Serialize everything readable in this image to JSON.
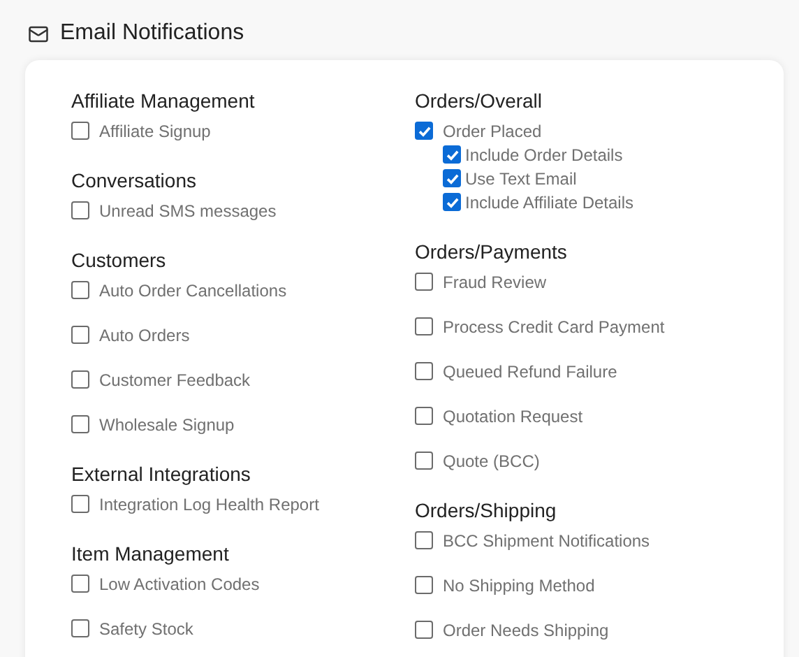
{
  "header": {
    "title": "Email Notifications"
  },
  "columns": [
    {
      "groups": [
        {
          "title": "Affiliate Management",
          "items": [
            {
              "label": "Affiliate Signup",
              "checked": false
            }
          ]
        },
        {
          "title": "Conversations",
          "items": [
            {
              "label": "Unread SMS messages",
              "checked": false
            }
          ]
        },
        {
          "title": "Customers",
          "items": [
            {
              "label": "Auto Order Cancellations",
              "checked": false
            },
            {
              "label": "Auto Orders",
              "checked": false
            },
            {
              "label": "Customer Feedback",
              "checked": false
            },
            {
              "label": "Wholesale Signup",
              "checked": false
            }
          ]
        },
        {
          "title": "External Integrations",
          "items": [
            {
              "label": "Integration Log Health Report",
              "checked": false
            }
          ]
        },
        {
          "title": "Item Management",
          "items": [
            {
              "label": "Low Activation Codes",
              "checked": false
            },
            {
              "label": "Safety Stock",
              "checked": false
            }
          ]
        }
      ]
    },
    {
      "groups": [
        {
          "title": "Orders/Overall",
          "items": [
            {
              "label": "Order Placed",
              "checked": true,
              "children": [
                {
                  "label": "Include Order Details",
                  "checked": true
                },
                {
                  "label": "Use Text Email",
                  "checked": true
                },
                {
                  "label": "Include Affiliate Details",
                  "checked": true
                }
              ]
            }
          ]
        },
        {
          "title": "Orders/Payments",
          "items": [
            {
              "label": "Fraud Review",
              "checked": false
            },
            {
              "label": "Process Credit Card Payment",
              "checked": false
            },
            {
              "label": "Queued Refund Failure",
              "checked": false
            },
            {
              "label": "Quotation Request",
              "checked": false
            },
            {
              "label": "Quote (BCC)",
              "checked": false
            }
          ]
        },
        {
          "title": "Orders/Shipping",
          "items": [
            {
              "label": "BCC Shipment Notifications",
              "checked": false
            },
            {
              "label": "No Shipping Method",
              "checked": false
            },
            {
              "label": "Order Needs Shipping",
              "checked": false
            }
          ]
        }
      ]
    }
  ]
}
